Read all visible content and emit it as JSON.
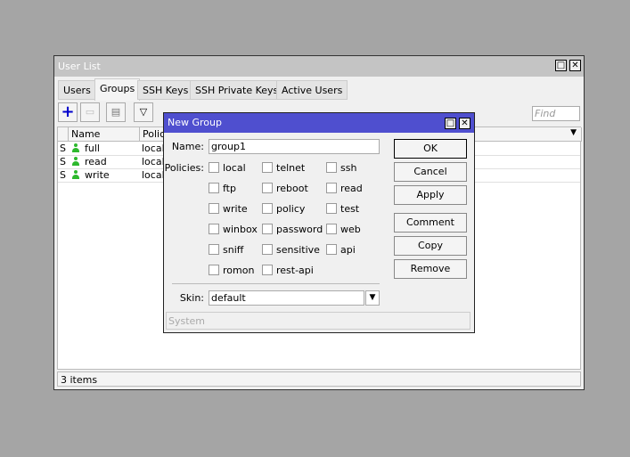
{
  "window": {
    "title": "User List"
  },
  "tabs": [
    "Users",
    "Groups",
    "SSH Keys",
    "SSH Private Keys",
    "Active Users"
  ],
  "active_tab": "Groups",
  "toolbar": {
    "find_placeholder": "Find"
  },
  "table": {
    "columns": [
      "Name",
      "Policies"
    ],
    "rows": [
      {
        "flag": "S",
        "name": "full",
        "policies": "local"
      },
      {
        "flag": "S",
        "name": "read",
        "policies": "local"
      },
      {
        "flag": "S",
        "name": "write",
        "policies": "local"
      }
    ]
  },
  "status": "3 items",
  "dialog": {
    "title": "New Group",
    "name_label": "Name:",
    "name_value": "group1",
    "policies_label": "Policies:",
    "policies": [
      "local",
      "telnet",
      "ssh",
      "ftp",
      "reboot",
      "read",
      "write",
      "policy",
      "test",
      "winbox",
      "password",
      "web",
      "sniff",
      "sensitive",
      "api",
      "romon",
      "rest-api"
    ],
    "skin_label": "Skin:",
    "skin_value": "default",
    "buttons": [
      "OK",
      "Cancel",
      "Apply",
      "Comment",
      "Copy",
      "Remove"
    ],
    "status": "System"
  },
  "colors": {
    "dialog_title": "#4f4fcf",
    "user_icon": "#2db82d",
    "add_icon": "#0000cc"
  }
}
